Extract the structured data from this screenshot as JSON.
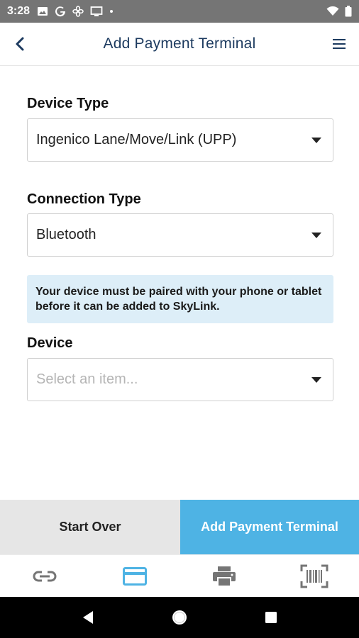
{
  "status_bar": {
    "time": "3:28",
    "icons_left": [
      "image-icon",
      "google-icon",
      "fan-icon",
      "cast-icon",
      "dot-icon"
    ],
    "icons_right": [
      "wifi-icon",
      "battery-icon"
    ]
  },
  "header": {
    "title": "Add Payment Terminal",
    "back_icon": "chevron-left-icon",
    "menu_icon": "hamburger-menu-icon"
  },
  "form": {
    "device_type": {
      "label": "Device Type",
      "value": "Ingenico Lane/Move/Link (UPP)"
    },
    "connection_type": {
      "label": "Connection Type",
      "value": "Bluetooth"
    },
    "info_message": "Your device must be paired with your phone or tablet before it can be added to SkyLink.",
    "device": {
      "label": "Device",
      "placeholder": "Select an item..."
    }
  },
  "actions": {
    "start_over_label": "Start Over",
    "add_terminal_label": "Add Payment Terminal"
  },
  "tabs": [
    {
      "icon": "link-icon",
      "active": false
    },
    {
      "icon": "credit-card-icon",
      "active": true
    },
    {
      "icon": "printer-icon",
      "active": false
    },
    {
      "icon": "barcode-scanner-icon",
      "active": false
    }
  ],
  "colors": {
    "primary": "#4eb3e4",
    "header_title": "#1c3a5f",
    "info_background": "#ddeef8",
    "inactive_tab_icon": "#757575"
  }
}
